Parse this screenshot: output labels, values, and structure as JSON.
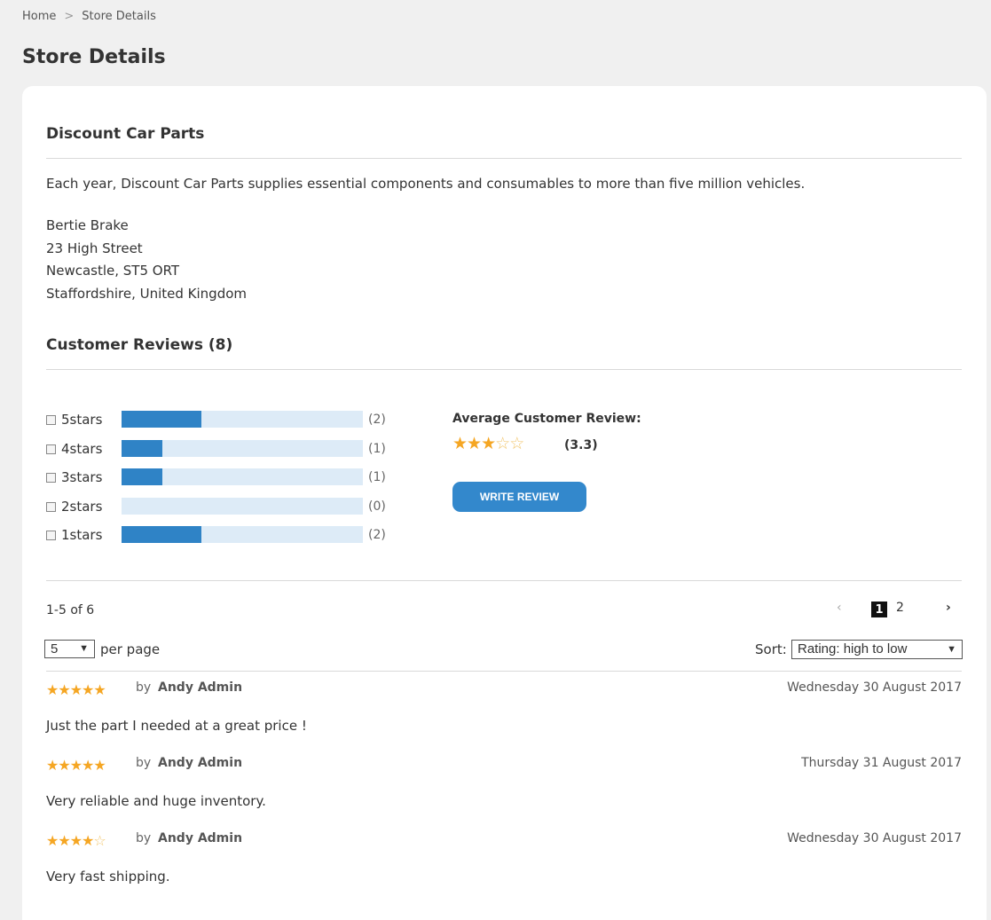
{
  "breadcrumb": {
    "home": "Home",
    "separator": ">",
    "current": "Store Details"
  },
  "page": {
    "title": "Store Details"
  },
  "store": {
    "name": "Discount Car Parts",
    "description": "Each year, Discount Car Parts supplies essential components and consumables to more than five million vehicles.",
    "address": [
      "Bertie Brake",
      "23 High Street",
      "Newcastle, ST5 ORT",
      "Staffordshire, United Kingdom"
    ]
  },
  "reviews_section": {
    "title": "Customer Reviews (8)",
    "histogram": [
      {
        "label": "5stars",
        "count": "(2)",
        "fraction": 0.33
      },
      {
        "label": "4stars",
        "count": "(1)",
        "fraction": 0.17
      },
      {
        "label": "3stars",
        "count": "(1)",
        "fraction": 0.17
      },
      {
        "label": "2stars",
        "count": "(0)",
        "fraction": 0.0
      },
      {
        "label": "1stars",
        "count": "(2)",
        "fraction": 0.33
      }
    ],
    "average_label": "Average Customer Review:",
    "average_stars": 3,
    "average_value": "(3.3)",
    "write_review_label": "WRITE REVIEW"
  },
  "listing": {
    "range": "1-5 of 6",
    "pager": {
      "prev": "‹",
      "pages": [
        "1",
        "2"
      ],
      "current": "1",
      "next": "›"
    },
    "per_page_value": "5",
    "per_page_label": "per page",
    "sort_label": "Sort:",
    "sort_value": "Rating: high to low"
  },
  "reviews": [
    {
      "stars": 5,
      "by": "by",
      "author": "Andy Admin",
      "date": "Wednesday 30 August 2017",
      "text": "Just the part I needed at a great price !"
    },
    {
      "stars": 5,
      "by": "by",
      "author": "Andy Admin",
      "date": "Thursday 31 August 2017",
      "text": "Very reliable and huge inventory."
    },
    {
      "stars": 4,
      "by": "by",
      "author": "Andy Admin",
      "date": "Wednesday 30 August 2017",
      "text": "Very fast shipping."
    }
  ],
  "colors": {
    "bar_fill": "#2f83c6",
    "bar_track": "#ddebf7",
    "star": "#f5a623",
    "button": "#3388cc"
  },
  "icons": {
    "star": "star-icon",
    "dropdown": "dropdown-arrow-icon",
    "prev": "chevron-left-icon",
    "next": "chevron-right-icon"
  }
}
